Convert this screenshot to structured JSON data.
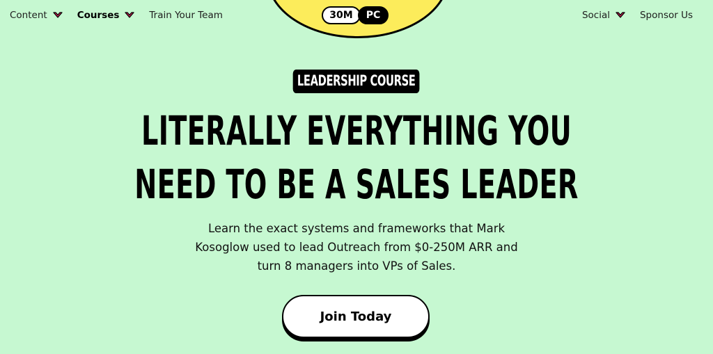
{
  "nav": {
    "left": [
      {
        "label": "Content",
        "has_dropdown": true
      },
      {
        "label": "Courses",
        "has_dropdown": true
      },
      {
        "label": "Train Your Team",
        "has_dropdown": false
      }
    ],
    "right": [
      {
        "label": "Social",
        "has_dropdown": true
      },
      {
        "label": "Sponsor Us",
        "has_dropdown": false
      }
    ],
    "chevron_color": "#e0245e"
  },
  "logo": {
    "part1": "30M",
    "part2": "PC",
    "blob_color": "#fcec5b"
  },
  "hero": {
    "badge": "LEADERSHIP COURSE",
    "headline_line1": "LITERALLY EVERYTHING YOU",
    "headline_line2": "NEED TO BE A SALES LEADER",
    "subtitle_line1": "Learn the exact systems and frameworks that Mark",
    "subtitle_line2": "Kosoglow used to lead Outreach from $0-250M ARR and",
    "subtitle_line3": "turn 8 managers into VPs of Sales.",
    "cta_label": "Join Today"
  },
  "colors": {
    "background": "#c6f8d1",
    "accent": "#e0245e"
  }
}
